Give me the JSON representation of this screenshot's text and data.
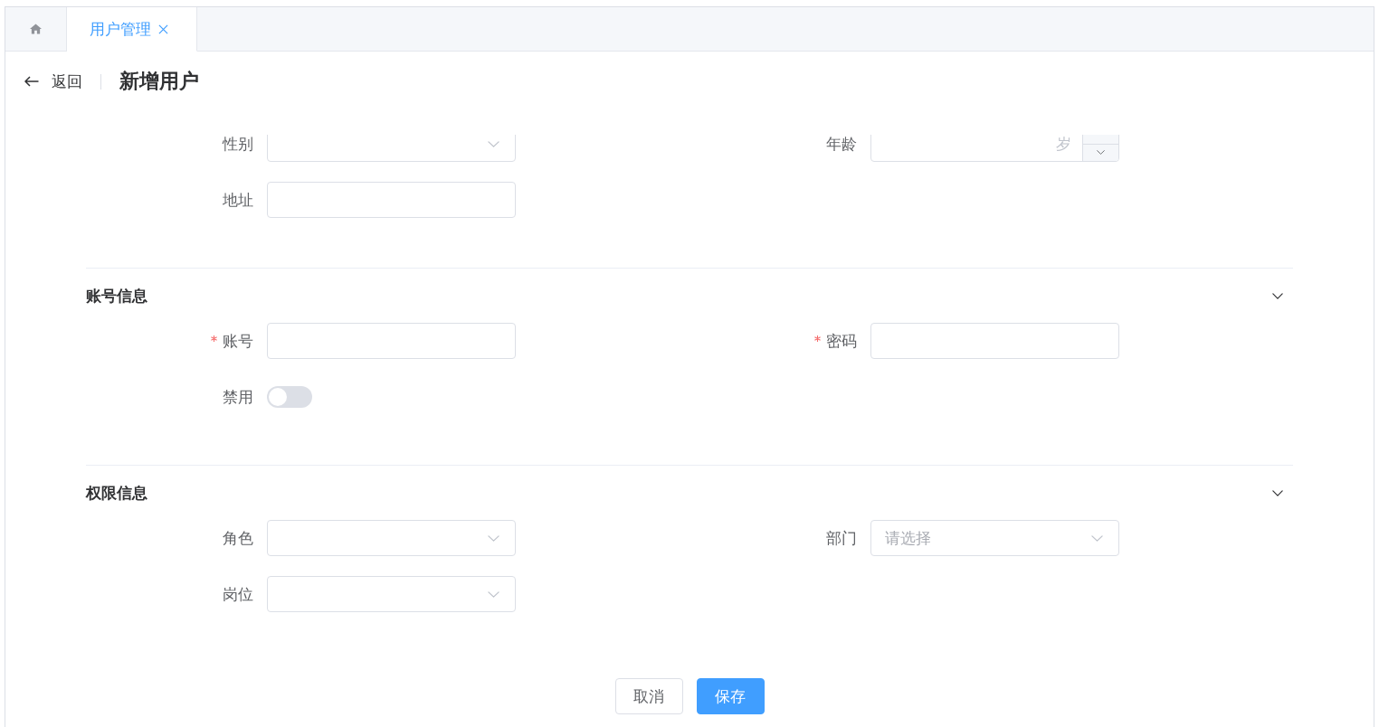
{
  "tabs": [
    {
      "kind": "home",
      "selected": false,
      "closable": false
    },
    {
      "kind": "page",
      "label": "用户管理",
      "selected": true,
      "closable": true
    }
  ],
  "page_header": {
    "back_label": "返回",
    "title": "新增用户"
  },
  "sections": [
    {
      "rows": [
        {
          "fields": [
            {
              "kind": "select",
              "label": "性别",
              "required": false
            },
            {
              "kind": "number",
              "label": "年龄",
              "suffix": "岁",
              "required": false
            }
          ]
        },
        {
          "fields": [
            {
              "kind": "input",
              "label": "地址",
              "required": false
            }
          ]
        }
      ]
    },
    {
      "title": "账号信息",
      "expanded": true,
      "rows": [
        {
          "fields": [
            {
              "kind": "input",
              "label": "账号",
              "required": true
            },
            {
              "kind": "input",
              "label": "密码",
              "required": true
            }
          ]
        },
        {
          "fields": [
            {
              "kind": "switch",
              "label": "禁用",
              "required": false,
              "on": false
            }
          ]
        }
      ]
    },
    {
      "title": "权限信息",
      "expanded": true,
      "rows": [
        {
          "fields": [
            {
              "kind": "select",
              "label": "角色",
              "required": false
            },
            {
              "kind": "select",
              "label": "部门",
              "required": false,
              "placeholder": "请选择"
            }
          ]
        },
        {
          "fields": [
            {
              "kind": "select",
              "label": "岗位",
              "required": false
            }
          ]
        }
      ]
    }
  ],
  "buttons": [
    {
      "kind": "default",
      "label": "取消"
    },
    {
      "kind": "primary",
      "label": "保存"
    }
  ]
}
